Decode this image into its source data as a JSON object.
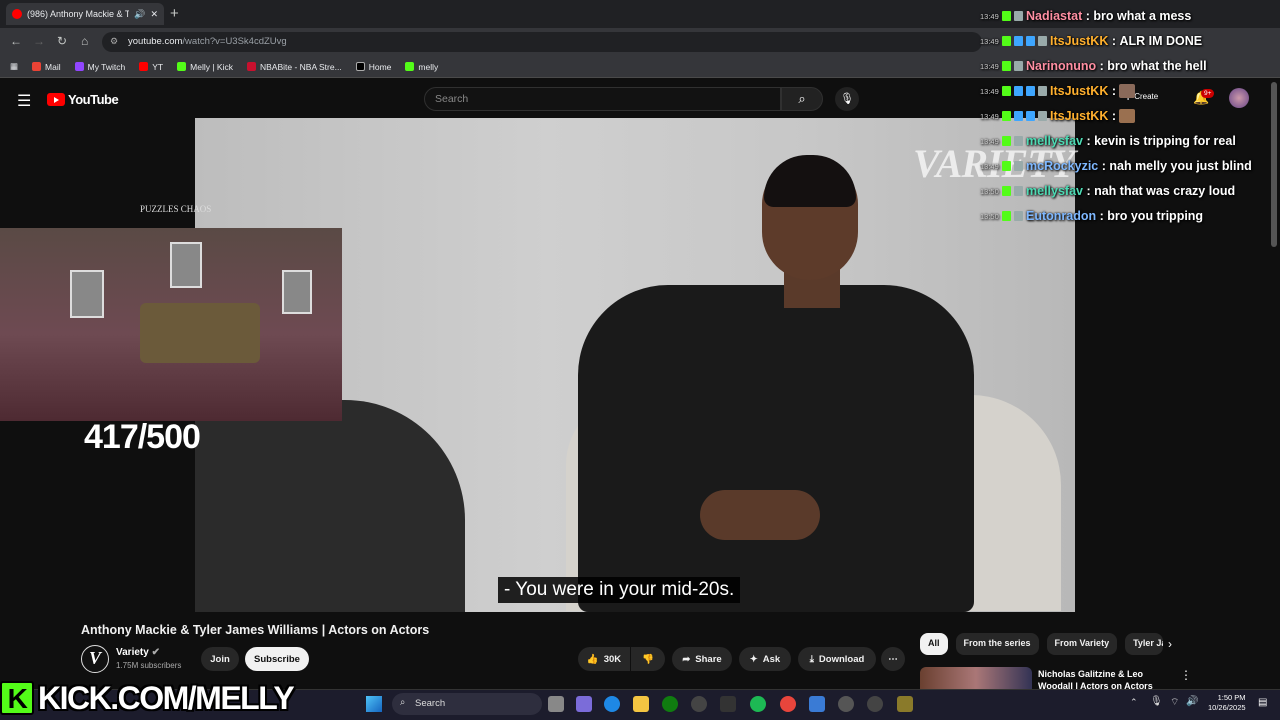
{
  "browser": {
    "tab_title": "(986) Anthony Mackie & Ty",
    "url_host": "youtube.com",
    "url_path": "/watch?v=U3Sk4cdZUvg",
    "bookmarks": [
      "Mail",
      "My Twitch",
      "YT",
      "Melly | Kick",
      "NBABite - NBA Stre...",
      "Home",
      "melly"
    ]
  },
  "youtube": {
    "logo_text": "YouTube",
    "search_placeholder": "Search",
    "create_label": "Create",
    "notif_badge": "9+",
    "video_title": "Anthony Mackie & Tyler James Williams | Actors on Actors",
    "channel_name": "Variety",
    "channel_subs": "1.75M subscribers",
    "join_label": "Join",
    "subscribe_label": "Subscribe",
    "likes": "30K",
    "share_label": "Share",
    "ask_label": "Ask",
    "download_label": "Download",
    "chips": [
      "All",
      "From the series",
      "From Variety",
      "Tyler Ja"
    ],
    "rec_title": "Nicholas Galitzine & Leo Woodall | Actors on Actors",
    "caption": "- You were in your mid-20s.",
    "watermark": "VARIETY"
  },
  "stream": {
    "counter": "417/500",
    "puzzles_label": "PUZZLES CHAOS",
    "kick_url": "KICK.COM/MELLY",
    "kick_letter": "K"
  },
  "chat": [
    {
      "time": "13:49",
      "user": "Nadiastat",
      "color": "#ff8fa3",
      "msg": "bro what a mess"
    },
    {
      "time": "13:49",
      "user": "ItsJustKK",
      "color": "#ffb02e",
      "msg": "ALR IM DONE"
    },
    {
      "time": "13:49",
      "user": "Narinonuno",
      "color": "#ff8fa3",
      "msg": "bro what the hell"
    },
    {
      "time": "13:49",
      "user": "ItsJustKK",
      "color": "#ffb02e",
      "msg": ""
    },
    {
      "time": "13:49",
      "user": "ItsJustKK",
      "color": "#ffb02e",
      "msg": ""
    },
    {
      "time": "13:49",
      "user": "mellysfav",
      "color": "#4ddbb4",
      "msg": "kevin is tripping for real"
    },
    {
      "time": "13:49",
      "user": "mcRockyzic",
      "color": "#7fb8ff",
      "msg": "nah melly you just blind"
    },
    {
      "time": "13:50",
      "user": "mellysfav",
      "color": "#4ddbb4",
      "msg": "nah that was crazy loud"
    },
    {
      "time": "13:50",
      "user": "Eutonradon",
      "color": "#7fb8ff",
      "msg": "bro you tripping"
    }
  ],
  "taskbar": {
    "search_label": "Search",
    "time": "1:50 PM",
    "date": "10/26/2025"
  }
}
